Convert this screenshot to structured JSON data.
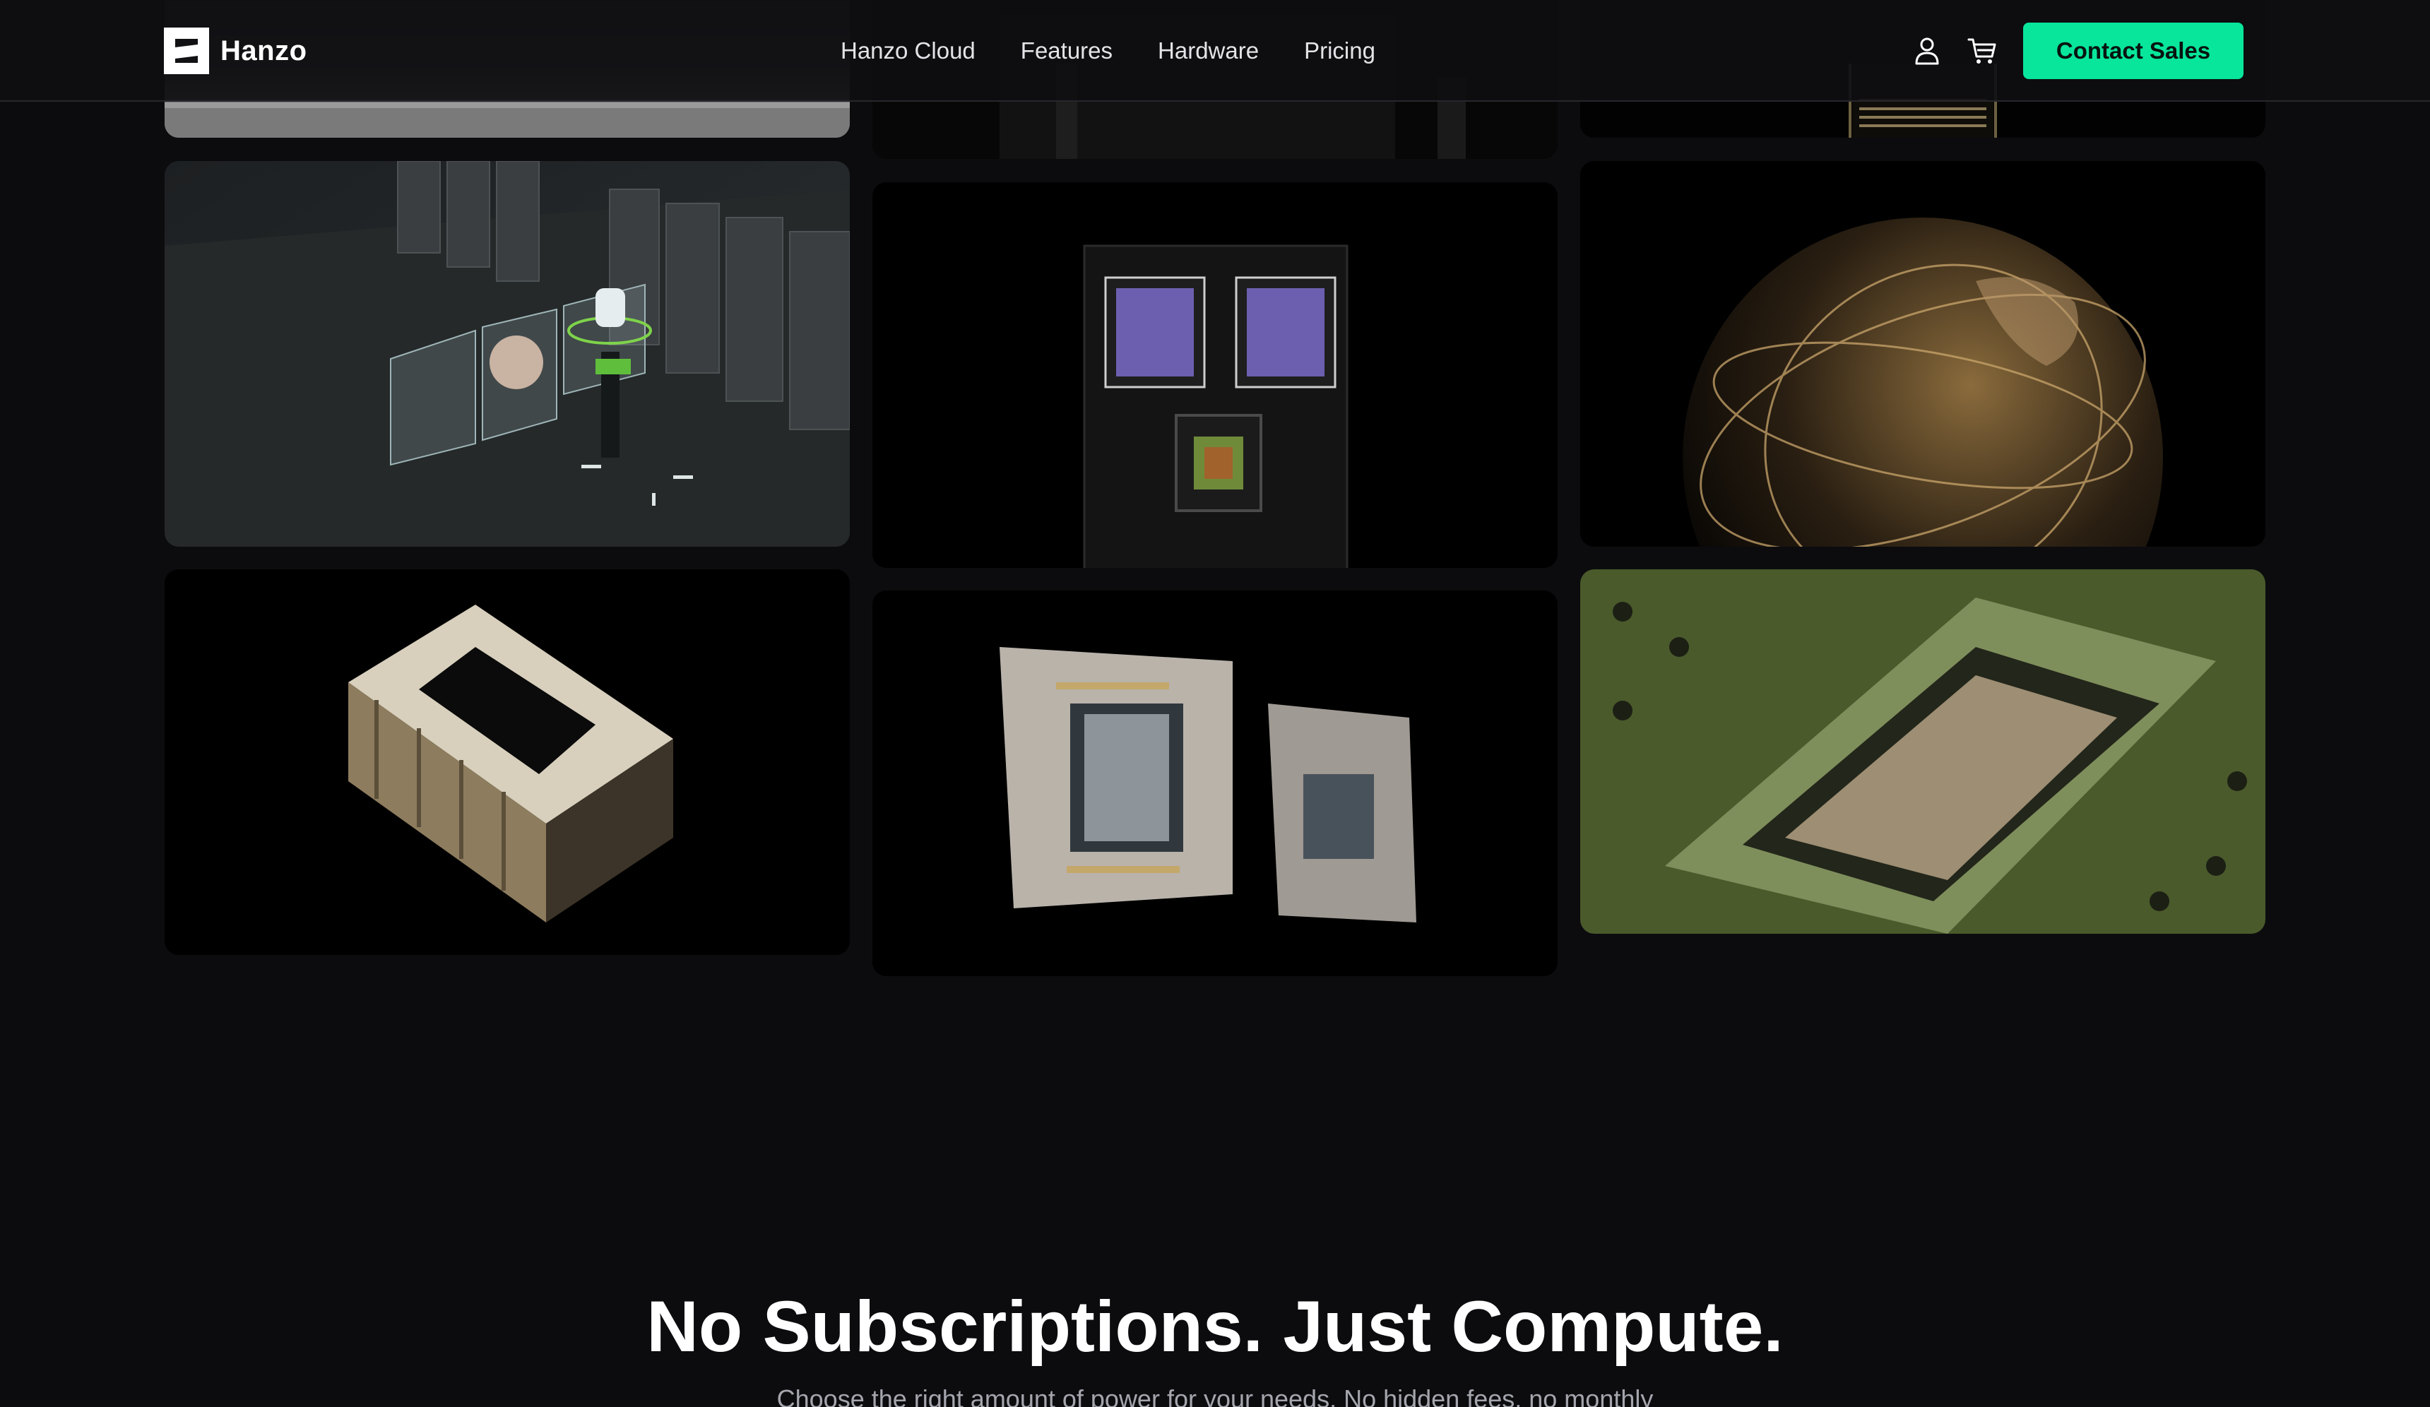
{
  "brand": {
    "name": "Hanzo",
    "logo_icon": "hanzo-logo-icon"
  },
  "nav": {
    "items": [
      {
        "label": "Hanzo Cloud"
      },
      {
        "label": "Features"
      },
      {
        "label": "Hardware"
      },
      {
        "label": "Pricing"
      }
    ]
  },
  "header_icons": {
    "account": "user-icon",
    "cart": "cart-icon"
  },
  "cta": {
    "label": "Contact Sales",
    "color": "#08e69c"
  },
  "gallery": {
    "images": [
      "rack-server-top",
      "server-hardware-top",
      "gpu-board-top",
      "datacenter-holographic-assistant",
      "superchip-board",
      "golden-globe-network",
      "gpu-module-stack",
      "gpu-chip-pair",
      "silicon-wafer-chip"
    ]
  },
  "pricing": {
    "title": "No Subscriptions. Just Compute.",
    "subtitle": "Choose the right amount of power for your needs. No hidden fees, no monthly"
  },
  "colors": {
    "background": "#0c0c0f",
    "accent": "#08e69c"
  }
}
